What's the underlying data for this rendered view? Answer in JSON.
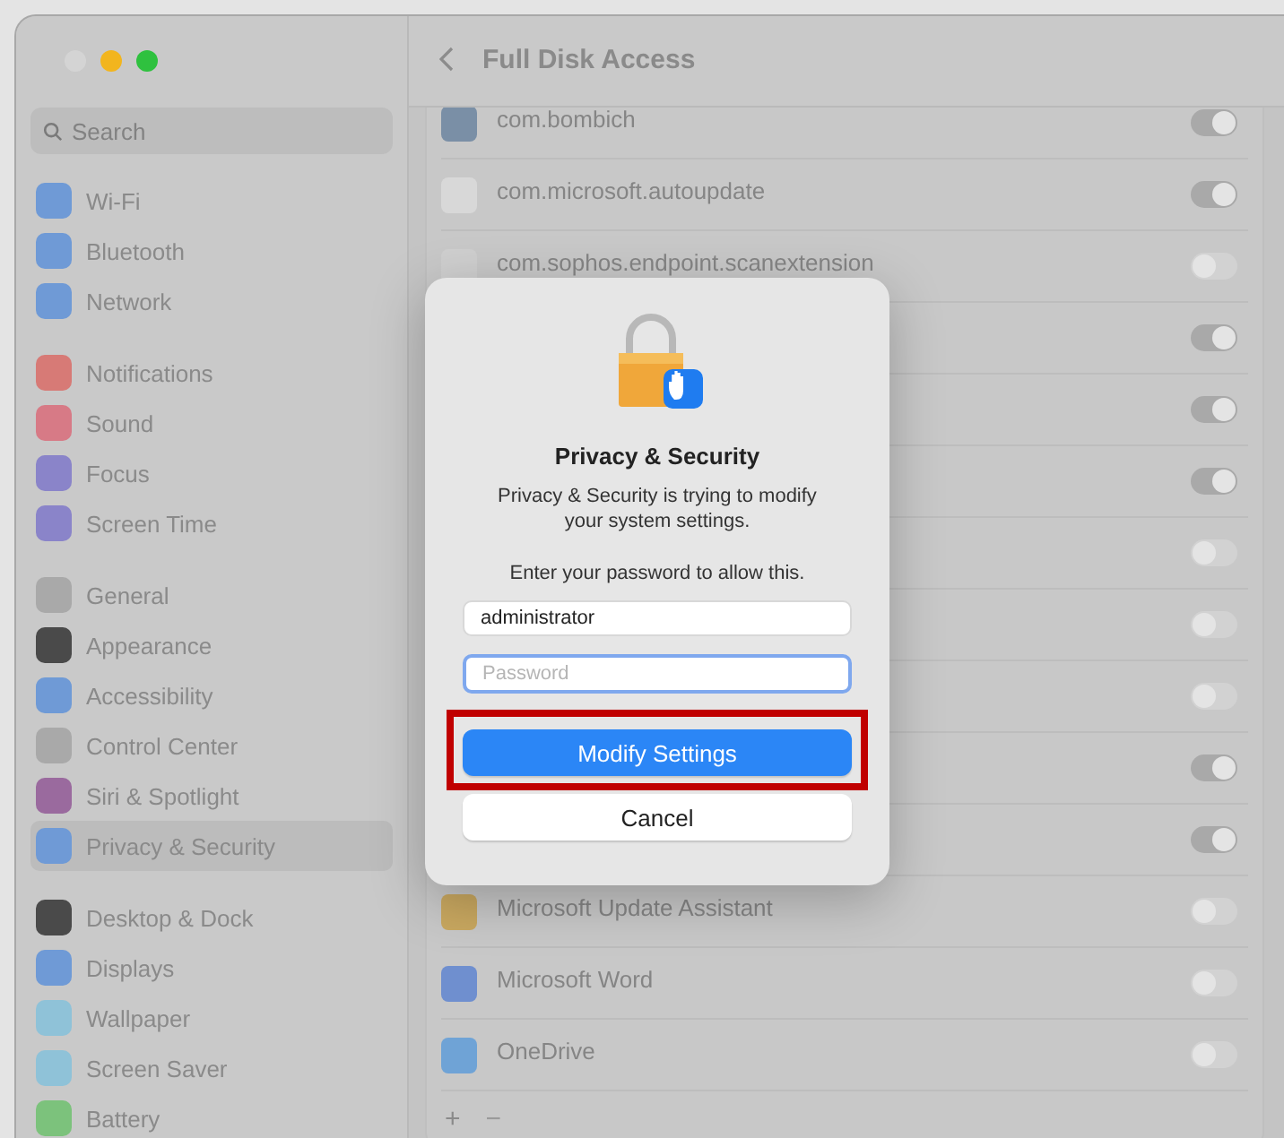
{
  "window": {
    "controls": [
      {
        "color": "#d4d4d4"
      },
      {
        "color": "#f2b51e"
      },
      {
        "color": "#2fc13f"
      }
    ]
  },
  "sidebar": {
    "search": {
      "placeholder": "Search"
    },
    "groups": [
      [
        {
          "label": "Wi-Fi",
          "color": "#6f9ad6",
          "selected": false
        },
        {
          "label": "Bluetooth",
          "color": "#6f9ad6",
          "selected": false
        },
        {
          "label": "Network",
          "color": "#6f9ad6",
          "selected": false
        }
      ],
      [
        {
          "label": "Notifications",
          "color": "#d77a76",
          "selected": false
        },
        {
          "label": "Sound",
          "color": "#d77a86",
          "selected": false
        },
        {
          "label": "Focus",
          "color": "#8a84c9",
          "selected": false
        },
        {
          "label": "Screen Time",
          "color": "#8a84c9",
          "selected": false
        }
      ],
      [
        {
          "label": "General",
          "color": "#a9a9a9",
          "selected": false
        },
        {
          "label": "Appearance",
          "color": "#4a4a4a",
          "selected": false
        },
        {
          "label": "Accessibility",
          "color": "#6f9ad6",
          "selected": false
        },
        {
          "label": "Control Center",
          "color": "#a9a9a9",
          "selected": false
        },
        {
          "label": "Siri & Spotlight",
          "color": "#9a6a9e",
          "selected": false
        },
        {
          "label": "Privacy & Security",
          "color": "#6f9ad6",
          "selected": true
        }
      ],
      [
        {
          "label": "Desktop & Dock",
          "color": "#4a4a4a",
          "selected": false
        },
        {
          "label": "Displays",
          "color": "#6f9ad6",
          "selected": false
        },
        {
          "label": "Wallpaper",
          "color": "#8fc2d8",
          "selected": false
        },
        {
          "label": "Screen Saver",
          "color": "#8fc2d8",
          "selected": false
        },
        {
          "label": "Battery",
          "color": "#7cc27c",
          "selected": false
        }
      ]
    ]
  },
  "main": {
    "title": "Full Disk Access",
    "apps": [
      {
        "name": "com.bombich",
        "color": "#7a8fa6",
        "on": true
      },
      {
        "name": "com.microsoft.autoupdate",
        "color": "#d8d8d8",
        "on": true
      },
      {
        "name": "com.sophos.endpoint.scanextension",
        "color": "#cfcfcf",
        "on": false
      },
      {
        "on": true
      },
      {
        "on": true
      },
      {
        "on": true
      },
      {
        "on": false
      },
      {
        "on": false
      },
      {
        "on": false
      },
      {
        "on": true
      },
      {
        "on": true
      },
      {
        "name": "Microsoft Update Assistant",
        "color": "#c9a860",
        "on": false
      },
      {
        "name": "Microsoft Word",
        "color": "#6f8fcf",
        "on": false
      },
      {
        "name": "OneDrive",
        "color": "#6fa3d6",
        "on": false
      }
    ],
    "footer": {
      "add": "+",
      "remove": "−"
    }
  },
  "dialog": {
    "title": "Privacy & Security",
    "message": "Privacy & Security is trying to modify your system settings.",
    "prompt": "Enter your password to allow this.",
    "username": {
      "value": "administrator"
    },
    "password": {
      "placeholder": "Password",
      "focused": true
    },
    "buttons": [
      {
        "label": "Modify Settings",
        "kind": "primary",
        "highlighted": true
      },
      {
        "label": "Cancel",
        "kind": "secondary",
        "highlighted": false
      }
    ]
  }
}
